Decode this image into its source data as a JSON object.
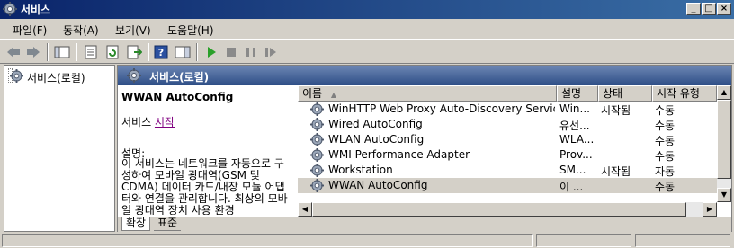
{
  "window": {
    "title": "서비스"
  },
  "menu": [
    "파일(F)",
    "동작(A)",
    "보기(V)",
    "도움말(H)"
  ],
  "tree": {
    "root_label": "서비스(로컬)"
  },
  "main": {
    "header": "서비스(로컬)",
    "extended": {
      "service_name": "WWAN AutoConfig",
      "action_prefix": "서비스",
      "action_link": "시작",
      "desc_label": "설명:",
      "description": "이 서비스는 네트워크를 자동으로 구성하여 모바일 광대역(GSM 및 CDMA) 데이터 카드/내장 모듈 어댑터와 연결을 관리합니다. 최상의 모바일 광대역 장치 사용 환경"
    },
    "tabs": [
      "확장",
      "표준"
    ]
  },
  "list": {
    "columns": [
      "이름",
      "설명",
      "상태",
      "시작 유형"
    ],
    "rows": [
      {
        "name": "WinHTTP Web Proxy Auto-Discovery Service",
        "desc": "Win...",
        "status": "시작됨",
        "startup": "수동"
      },
      {
        "name": "Wired AutoConfig",
        "desc": "유선...",
        "status": "",
        "startup": "수동"
      },
      {
        "name": "WLAN AutoConfig",
        "desc": "WLA...",
        "status": "",
        "startup": "수동"
      },
      {
        "name": "WMI Performance Adapter",
        "desc": "Prov...",
        "status": "",
        "startup": "수동"
      },
      {
        "name": "Workstation",
        "desc": "SM...",
        "status": "시작됨",
        "startup": "자동"
      },
      {
        "name": "WWAN AutoConfig",
        "desc": "이 ...",
        "status": "",
        "startup": "수동"
      }
    ],
    "selected_index": 5
  },
  "colors": {
    "title_start": "#0a246a",
    "title_end": "#3a6ea5",
    "header_top": "#6c86b4",
    "header_bottom": "#2e4e86",
    "link": "#800080"
  }
}
